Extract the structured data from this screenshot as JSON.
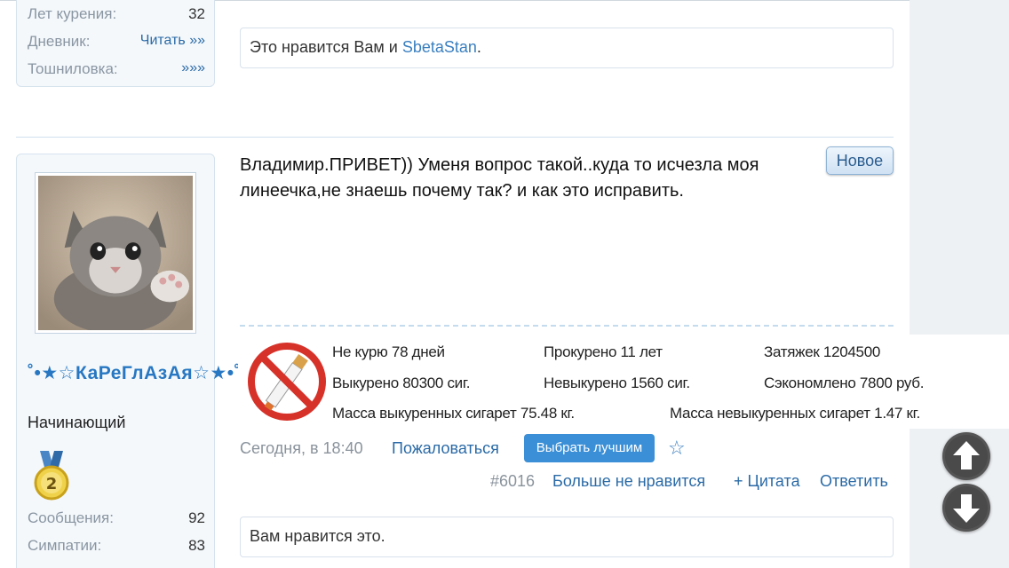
{
  "top_user": {
    "stats": [
      {
        "label": "Лет курения:",
        "value": "32"
      },
      {
        "label": "Дневник:",
        "value": "Читать »»"
      },
      {
        "label": "Тошниловка:",
        "value": "»»»"
      }
    ]
  },
  "top_post": {
    "likes_prefix": "Это нравится Вам и ",
    "likes_user": "SbetaStan",
    "likes_suffix": "."
  },
  "post": {
    "author": {
      "name": "˚•★☆КаРеГлАзАя☆★•˚",
      "title": "Начинающий",
      "stats": [
        {
          "label": "Сообщения:",
          "value": "92"
        },
        {
          "label": "Симпатии:",
          "value": "83"
        }
      ]
    },
    "badge": "Новое",
    "text": "Владимир.ПРИВЕТ)) Уменя вопрос такой..куда то исчезла моя линеечка,не знаешь почему так? и как это исправить.",
    "signature": {
      "items": [
        "Не курю 78 дней",
        "Прокурено 11 лет",
        "Затяжек 1204500",
        "Выкурено 80300 сиг.",
        "Невыкурено 1560 сиг.",
        "Сэкономлено 7800 руб.",
        "Масса выкуренных сигарет 75.48 кг.",
        "Масса невыкуренных сигарет 1.47 кг."
      ]
    },
    "date": "Сегодня, в 18:40",
    "report": "Пожаловаться",
    "best_button": "Выбрать лучшим",
    "number": "#6016",
    "unlike": "Больше не нравится",
    "quote": "+ Цитата",
    "reply": "Ответить",
    "likes_text": "Вам нравится это."
  },
  "colors": {
    "accent": "#3b8fd6",
    "link": "#2a6aa6",
    "username": "#2777c2"
  },
  "icons": {
    "scroll_up": "arrow-up-icon",
    "scroll_down": "arrow-down-icon",
    "no_smoking": "no-smoking-icon",
    "medal": "medal-icon",
    "star": "star-icon"
  }
}
